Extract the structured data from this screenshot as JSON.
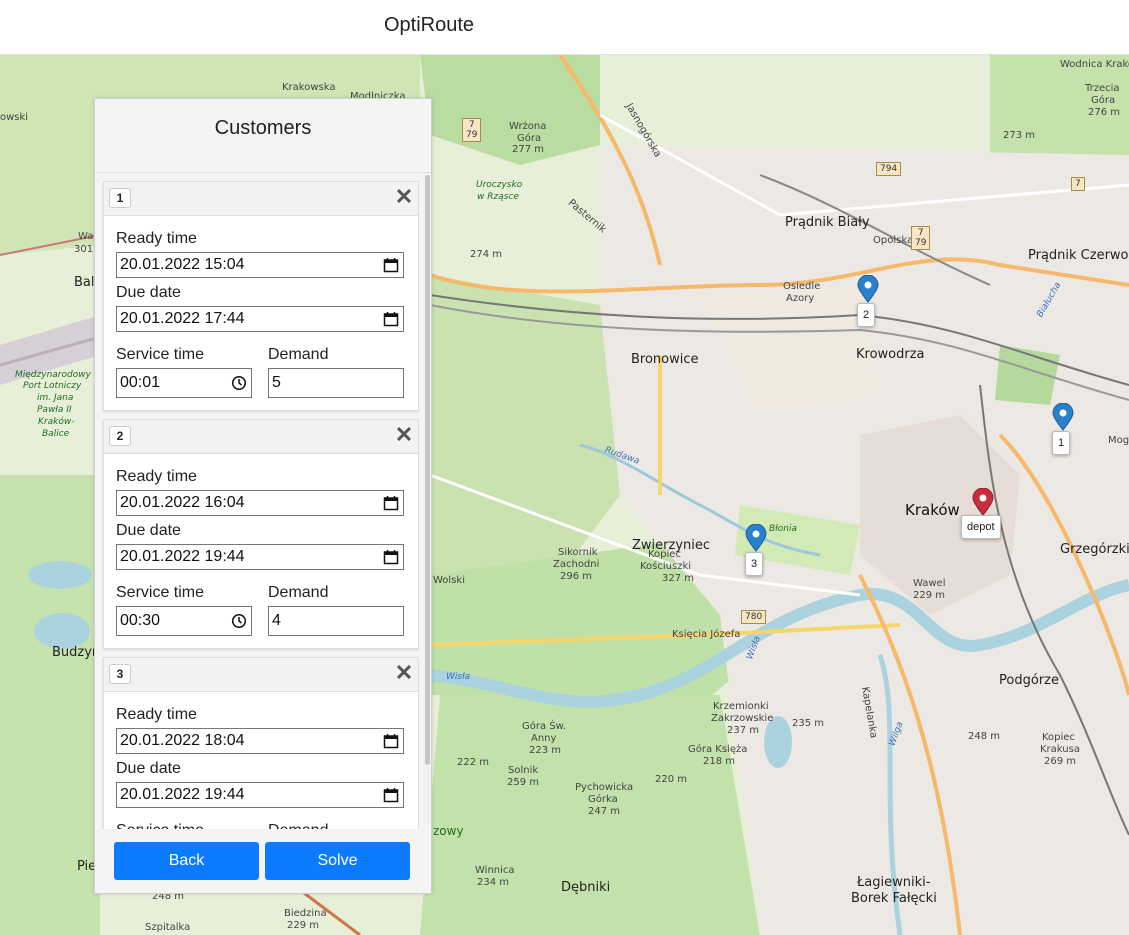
{
  "app": {
    "title": "OptiRoute"
  },
  "panel": {
    "title": "Customers",
    "labels": {
      "ready": "Ready time",
      "due": "Due date",
      "service": "Service time",
      "demand": "Demand"
    },
    "customers": [
      {
        "id": "1",
        "ready": "20.01.2022 15:04",
        "due": "20.01.2022 17:44",
        "service": "00:01",
        "demand": "5"
      },
      {
        "id": "2",
        "ready": "20.01.2022 16:04",
        "due": "20.01.2022 19:44",
        "service": "00:30",
        "demand": "4"
      },
      {
        "id": "3",
        "ready": "20.01.2022 18:04",
        "due": "20.01.2022 19:44",
        "service": "",
        "demand": ""
      }
    ],
    "back_label": "Back",
    "solve_label": "Solve"
  },
  "map": {
    "markers": [
      {
        "label": "2",
        "color": "#2a81cb"
      },
      {
        "label": "1",
        "color": "#2a81cb"
      },
      {
        "label": "3",
        "color": "#2a81cb"
      },
      {
        "label": "depot",
        "color": "#cb2b3e"
      }
    ],
    "places": {
      "krakow": "Kraków",
      "pradnik_bialy": "Prądnik Biały",
      "pradnik_czerwony": "Prądnik Czerwony",
      "bronowice": "Bronowice",
      "krowodrza": "Krowodrza",
      "zwierzyniec": "Zwierzyniec",
      "grzegorzki": "Grzegórzki",
      "podgorze": "Podgórze",
      "debniki": "Dębniki",
      "lagiewniki": "Łagiewniki-",
      "borek": "Borek Fałęcki",
      "budzyn": "Budzyń",
      "bali": "Bali",
      "osiedle": "Osiedle",
      "azory": "Azory",
      "wrzona": "Wrżona",
      "gora": "Góra",
      "m277": "277 m",
      "sikornik": "Sikornik",
      "zachodni": "Zachodni",
      "m296": "296 m",
      "kopiec": "Kopiec",
      "koscius": "Kościuszki",
      "m327": "327 m",
      "wawel": "Wawel",
      "m229": "229 m",
      "solnik": "Solnik",
      "m259": "259 m",
      "pychowicka": "Pychowicka",
      "gorka": "Górka",
      "m247": "247 m",
      "winnica": "Winnica",
      "m234": "234 m",
      "m248": "248 m",
      "m273": "273 m",
      "m274": "274 m",
      "m220": "220 m",
      "m222": "222 m",
      "m235": "235 m",
      "m237": "237 m",
      "krzemionki": "Krzemionki",
      "zakrzow": "Zakrzowskie",
      "goraksiezna": "Góra Księża",
      "m218": "218 m",
      "kopieckrak": "Kopiec",
      "krakusa": "Krakusa",
      "m269": "269 m",
      "trzecia": "Trzecia",
      "gora2": "Góra",
      "m276": "276 m",
      "biedzina": "Biedzina",
      "m229b": "229 m",
      "szpitalka": "Szpitalka",
      "airport1": "Międzynarodowy",
      "airport2": "Port Lotniczy",
      "airport3": "im. Jana",
      "airport4": "Pawła II",
      "airport5": "Kraków-",
      "airport6": "Balice",
      "uroczysko": "Uroczysko",
      "wrzasce": "w Rząsce",
      "blonia": "Błonia",
      "rudawa": "Rudawa",
      "wisla": "Wisła",
      "wisla2": "Wisła",
      "zowy": "zowy",
      "wolski": "Wolski",
      "krakowska": "Krakowska",
      "modlniczka": "Modlniczka",
      "jasnogorska": "Jasnogórska",
      "pasternik": "Pasternik",
      "opolska": "Opolska",
      "ksiecia": "Księcia Józefa",
      "kapelanka": "Kapelanka",
      "wilga": "Wilga",
      "sluzka": "Białucha",
      "pie": "Pie",
      "wa": "Wa",
      "m301": "301",
      "owski": "owski",
      "gorasw": "Góra Św.",
      "anny": "Anny",
      "m223": "223 m",
      "mogil": "Mogil",
      "wodnica": "Wodnica Krakowa"
    },
    "shields": [
      "7",
      "79",
      "794",
      "7",
      "79",
      "7",
      "780"
    ]
  }
}
